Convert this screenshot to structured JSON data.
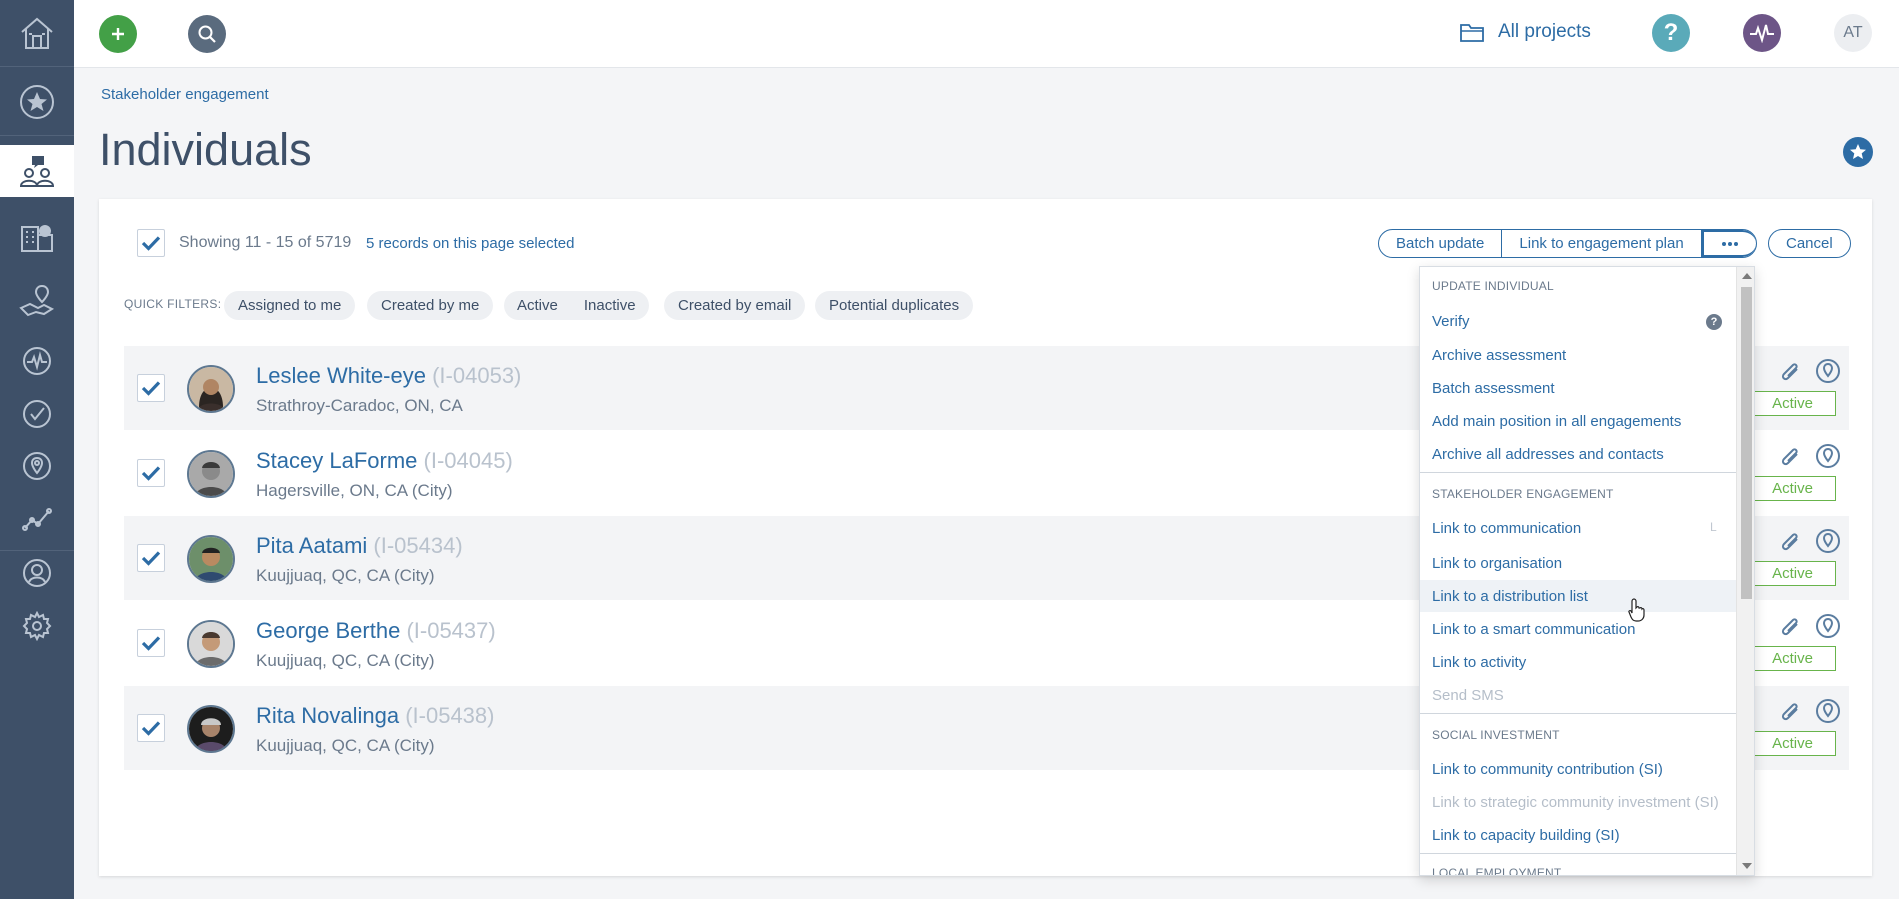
{
  "sidebar": {
    "items": [
      {
        "icon": "home-icon"
      },
      {
        "icon": "star-icon"
      },
      {
        "icon": "stakeholder-engagement-icon"
      },
      {
        "icon": "buildings-icon"
      },
      {
        "icon": "location-handshake-icon"
      },
      {
        "icon": "activity-pulse-icon"
      },
      {
        "icon": "task-check-icon"
      },
      {
        "icon": "map-pin-icon"
      },
      {
        "icon": "analytics-line-icon"
      },
      {
        "icon": "user-icon"
      },
      {
        "icon": "settings-gear-icon"
      }
    ]
  },
  "topbar": {
    "add_icon": "plus-icon",
    "search_icon": "search-icon",
    "all_projects": "All projects",
    "help_label": "?",
    "user_initials": "AT"
  },
  "breadcrumb": "Stakeholder engagement",
  "page_title": "Individuals",
  "toolbar": {
    "showing": "Showing 11 - 15 of 5719",
    "selected": "5 records on this page selected",
    "batch_update": "Batch update",
    "link_engagement_plan": "Link to engagement plan",
    "more": "•••",
    "cancel": "Cancel"
  },
  "quick_filters": {
    "label": "QUICK FILTERS:",
    "assigned_to_me": "Assigned to me",
    "created_by_me": "Created by me",
    "active": "Active",
    "inactive": "Inactive",
    "created_by_email": "Created by email",
    "potential_duplicates": "Potential duplicates"
  },
  "rows": [
    {
      "name": "Leslee White-eye",
      "id": "(I-04053)",
      "location": "Strathroy-Caradoc, ON, CA",
      "status": "Active"
    },
    {
      "name": "Stacey LaForme",
      "id": "(I-04045)",
      "location": "Hagersville, ON, CA (City)",
      "status": "Active"
    },
    {
      "name": "Pita Aatami",
      "id": "(I-05434)",
      "location": "Kuujjuaq, QC, CA (City)",
      "status": "Active"
    },
    {
      "name": "George Berthe",
      "id": "(I-05437)",
      "location": "Kuujjuaq, QC, CA (City)",
      "status": "Active"
    },
    {
      "name": "Rita Novalinga",
      "id": "(I-05438)",
      "location": "Kuujjuaq, QC, CA (City)",
      "status": "Active"
    }
  ],
  "menu": {
    "update_individual_header": "UPDATE INDIVIDUAL",
    "verify": "Verify",
    "archive_assessment": "Archive assessment",
    "batch_assessment": "Batch assessment",
    "add_main_position": "Add main position in all engagements",
    "archive_addresses": "Archive all addresses and contacts",
    "stakeholder_engagement_header": "STAKEHOLDER ENGAGEMENT",
    "link_communication": "Link to communication",
    "link_communication_shortcut": "L",
    "link_organisation": "Link to organisation",
    "link_distribution_list": "Link to a distribution list",
    "link_smart_communication": "Link to a smart communication",
    "link_activity": "Link to activity",
    "send_sms": "Send SMS",
    "social_investment_header": "SOCIAL INVESTMENT",
    "link_community_contribution": "Link to community contribution (SI)",
    "link_strategic_investment": "Link to strategic community investment (SI)",
    "link_capacity_building": "Link to capacity building (SI)",
    "local_employment_header": "LOCAL EMPLOYMENT"
  },
  "colors": {
    "sidebar_bg": "#3e5068",
    "accent_blue": "#2d6ca5",
    "add_green": "#43a047",
    "help_teal": "#5aaab9",
    "pulse_purple": "#6d5587",
    "status_green": "#68b44b"
  }
}
